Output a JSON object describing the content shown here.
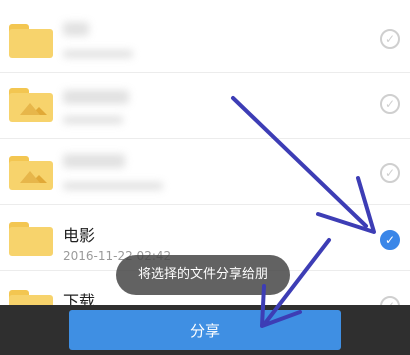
{
  "files": [
    {
      "name": "",
      "date": "",
      "selected": false,
      "blurred": true,
      "icon": "folder-icon"
    },
    {
      "name": "",
      "date": "",
      "selected": false,
      "blurred": true,
      "icon": "image-folder-icon"
    },
    {
      "name": "",
      "date": "",
      "selected": false,
      "blurred": true,
      "icon": "image-folder-icon"
    },
    {
      "name": "电影",
      "date": "2016-11-22 02:42",
      "selected": true,
      "blurred": false,
      "icon": "folder-icon"
    },
    {
      "name": "下载",
      "date": "",
      "selected": false,
      "blurred": false,
      "icon": "folder-icon"
    }
  ],
  "toast": {
    "text": "将选择的文件分享给朋"
  },
  "bottom_bar": {
    "share_label": "分享"
  },
  "colors": {
    "accent": "#3f8fe3",
    "check_on": "#3a86e8",
    "folder": "#f7d36c",
    "arrow": "#3d3db5"
  }
}
